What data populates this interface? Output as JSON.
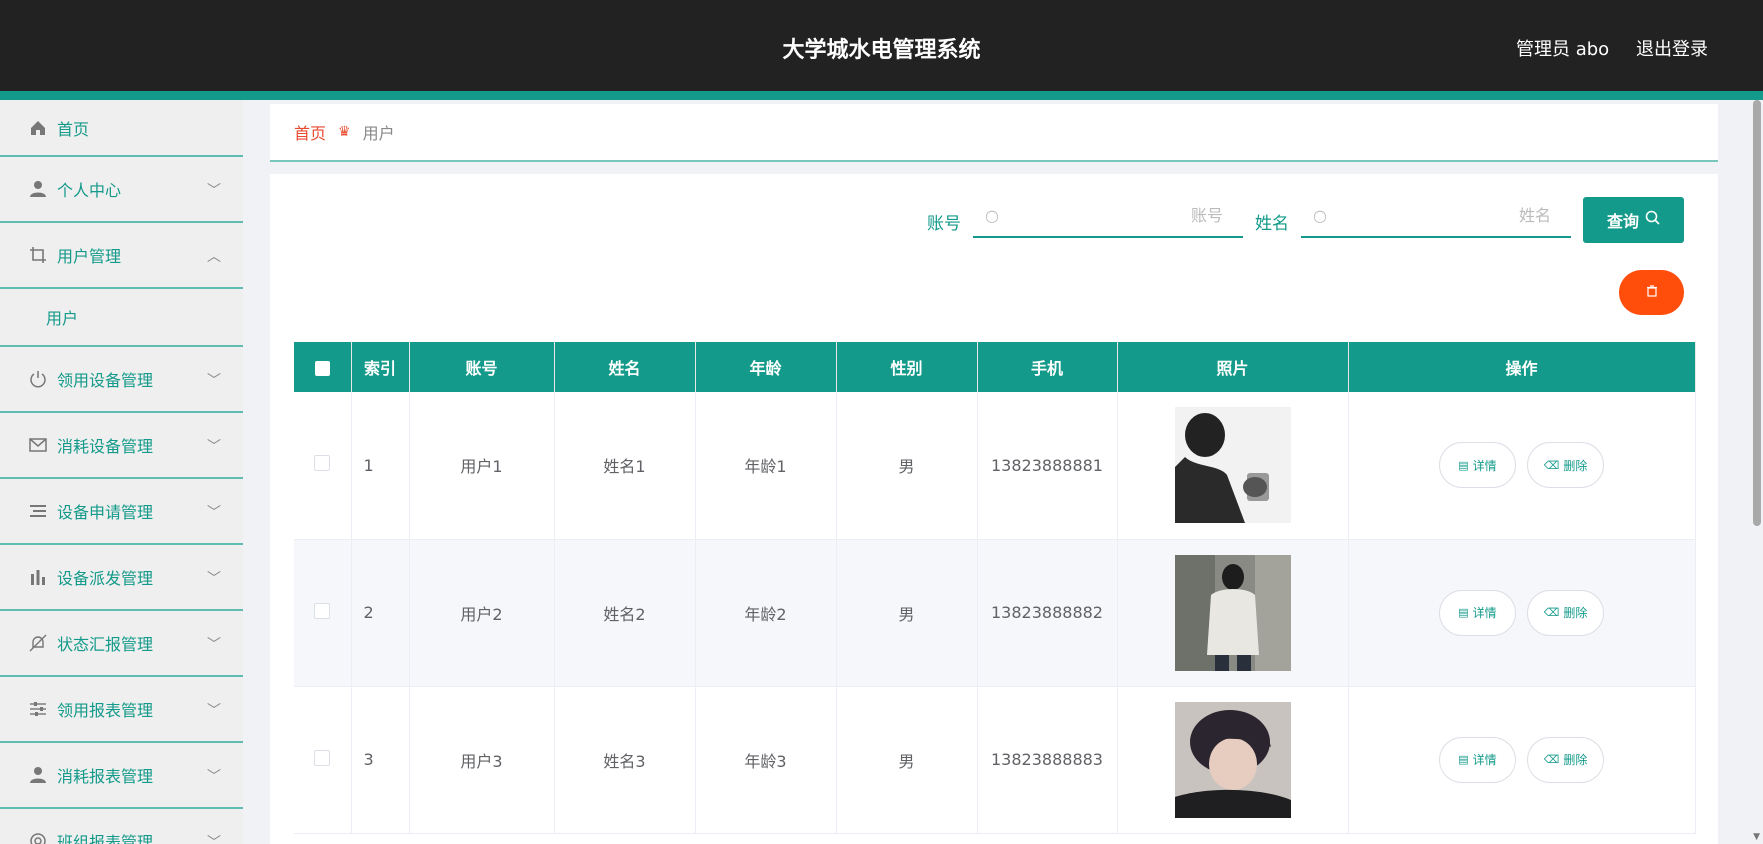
{
  "header": {
    "title": "大学城水电管理系统",
    "user_label": "管理员 abo",
    "logout": "退出登录"
  },
  "sidebar": {
    "items": [
      {
        "label": "首页",
        "icon": "home-icon"
      },
      {
        "label": "个人中心",
        "icon": "user-icon"
      },
      {
        "label": "用户管理",
        "icon": "crop-icon",
        "expanded": true,
        "children": [
          {
            "label": "用户"
          }
        ]
      },
      {
        "label": "领用设备管理",
        "icon": "power-icon"
      },
      {
        "label": "消耗设备管理",
        "icon": "mail-icon"
      },
      {
        "label": "设备申请管理",
        "icon": "list-icon"
      },
      {
        "label": "设备派发管理",
        "icon": "bar-chart-icon"
      },
      {
        "label": "状态汇报管理",
        "icon": "bell-off-icon"
      },
      {
        "label": "领用报表管理",
        "icon": "sliders-icon"
      },
      {
        "label": "消耗报表管理",
        "icon": "user-icon"
      },
      {
        "label": "班组报表管理",
        "icon": "circle-icon"
      }
    ]
  },
  "breadcrumb": {
    "home": "首页",
    "current": "用户"
  },
  "search": {
    "account_label": "账号",
    "account_placeholder": "账号",
    "name_label": "姓名",
    "name_placeholder": "姓名",
    "query_label": "查询"
  },
  "table": {
    "columns": [
      "索引",
      "账号",
      "姓名",
      "年龄",
      "性别",
      "手机",
      "照片",
      "操作"
    ],
    "rows": [
      {
        "index": "1",
        "account": "用户1",
        "name": "姓名1",
        "age": "年龄1",
        "gender": "男",
        "phone": "13823888881"
      },
      {
        "index": "2",
        "account": "用户2",
        "name": "姓名2",
        "age": "年龄2",
        "gender": "男",
        "phone": "13823888882"
      },
      {
        "index": "3",
        "account": "用户3",
        "name": "姓名3",
        "age": "年龄3",
        "gender": "男",
        "phone": "13823888883"
      }
    ],
    "detail_label": "详情",
    "delete_label": "删除"
  },
  "colors": {
    "accent": "#139a8a",
    "danger": "#ff4e0c",
    "header_bg": "#222222"
  }
}
